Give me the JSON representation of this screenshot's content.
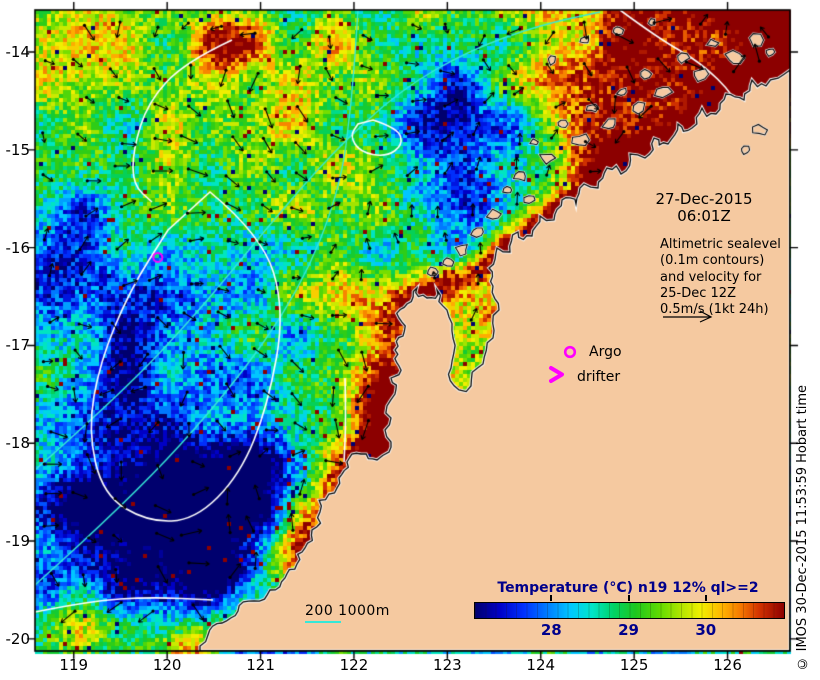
{
  "axes": {
    "x_tick_labels": [
      "119",
      "120",
      "121",
      "122",
      "123",
      "124",
      "125",
      "126"
    ],
    "x_tick_values": [
      119,
      120,
      121,
      122,
      123,
      124,
      125,
      126
    ],
    "y_tick_labels": [
      "-14",
      "-15",
      "-16",
      "-17",
      "-18",
      "-19",
      "-20"
    ],
    "y_tick_values": [
      -14,
      -15,
      -16,
      -17,
      -18,
      -19,
      -20
    ]
  },
  "annotations": {
    "datetime_line1": "27-Dec-2015",
    "datetime_line2": "06:01Z",
    "altimetric": [
      "Altimetric sealevel",
      "(0.1m contours)",
      "and velocity for",
      "25-Dec 12Z",
      "0.5m/s (1kt 24h)"
    ],
    "argo_label": "Argo",
    "drifter_label": "drifter",
    "depth_scale_label": "200 1000m",
    "copyright": "© IMOS 30-Dec-2015 11:53:59 Hobart time"
  },
  "colorbar": {
    "title": "Temperature (°C) n19 12% ql>=2",
    "tick_labels": [
      "28",
      "29",
      "30"
    ],
    "tick_values": [
      28,
      29,
      30
    ],
    "range_min": 27,
    "range_max": 31
  },
  "markers": {
    "argo_on_map": {
      "lon": 119.9,
      "lat": -16.1
    }
  },
  "colors": {
    "land": "#f5c9a0",
    "magenta": "#ff00ff",
    "navy_text": "#00008b",
    "bathy_contour": "#35e8d8",
    "sealevel_contour": "#ffffff",
    "vector_black": "#000000",
    "palette": [
      [
        0.0,
        "#00006e"
      ],
      [
        0.08,
        "#0000c8"
      ],
      [
        0.16,
        "#0032ff"
      ],
      [
        0.24,
        "#0082ff"
      ],
      [
        0.31,
        "#00c8ff"
      ],
      [
        0.38,
        "#00e6c8"
      ],
      [
        0.45,
        "#00d264"
      ],
      [
        0.52,
        "#1ec81e"
      ],
      [
        0.6,
        "#64dc00"
      ],
      [
        0.67,
        "#b4e600"
      ],
      [
        0.73,
        "#f0f000"
      ],
      [
        0.8,
        "#ffb400"
      ],
      [
        0.86,
        "#f57800"
      ],
      [
        0.92,
        "#d23200"
      ],
      [
        1.0,
        "#8c0000"
      ]
    ]
  }
}
